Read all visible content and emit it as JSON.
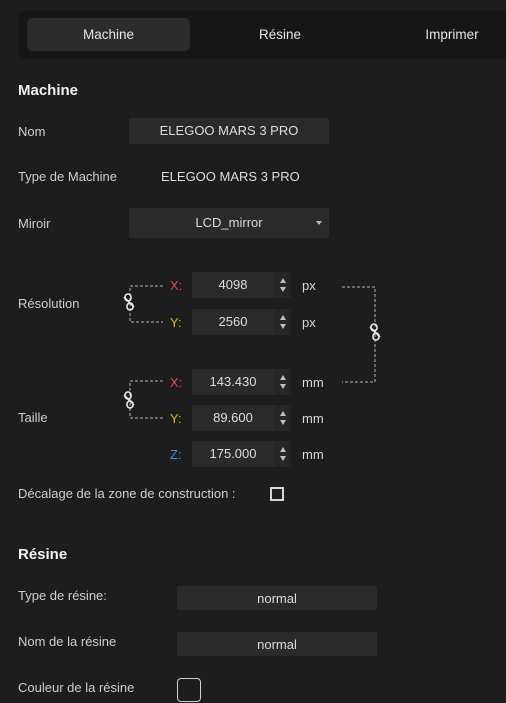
{
  "tabs": [
    {
      "label": "Machine"
    },
    {
      "label": "Résine"
    },
    {
      "label": "Imprimer"
    }
  ],
  "machine": {
    "section_title": "Machine",
    "name_label": "Nom",
    "name_value": "ELEGOO MARS 3 PRO",
    "type_label": "Type de Machine",
    "type_value": "ELEGOO MARS 3 PRO",
    "mirror_label": "Miroir",
    "mirror_value": "LCD_mirror",
    "resolution_label": "Résolution",
    "resolution": {
      "x_axis": "X:",
      "x_value": "4098",
      "x_unit": "px",
      "y_axis": "Y:",
      "y_value": "2560",
      "y_unit": "px"
    },
    "size_label": "Taille",
    "size": {
      "x_axis": "X:",
      "x_value": "143.430",
      "x_unit": "mm",
      "y_axis": "Y:",
      "y_value": "89.600",
      "y_unit": "mm",
      "z_axis": "Z:",
      "z_value": "175.000",
      "z_unit": "mm"
    },
    "offset_label": "Décalage de la zone de construction :"
  },
  "resin": {
    "section_title": "Résine",
    "type_label": "Type de résine:",
    "type_value": "normal",
    "name_label": "Nom de la résine",
    "name_value": "normal",
    "color_label": "Couleur de la résine"
  },
  "colors": {
    "background": "#1d1d1d",
    "field": "#2a2a2a",
    "axis_x": "#e04848",
    "axis_y": "#e0b020",
    "axis_z": "#3c8fe0"
  }
}
